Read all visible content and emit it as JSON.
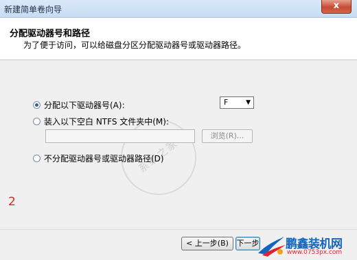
{
  "window": {
    "title": "新建简单卷向导",
    "close_symbol": "x"
  },
  "header": {
    "title": "分配驱动器号和路径",
    "subtitle": "为了便于访问，可以给磁盘分区分配驱动器号或驱动器路径。"
  },
  "watermark_text": "系统之家",
  "options": [
    {
      "label": "分配以下驱动器号(A):",
      "checked": true
    },
    {
      "label": "装入以下空白 NTFS 文件夹中(M):",
      "checked": false
    },
    {
      "label": "不分配驱动器号或驱动器路径(D)",
      "checked": false
    }
  ],
  "drive_select": {
    "value": "F",
    "arrow": "▼"
  },
  "path_input": {
    "value": ""
  },
  "browse_button": {
    "label": "浏览(R)..."
  },
  "annotation_number": "2",
  "footer": {
    "back_label": "< 上一步(B)",
    "next_label": "下一步"
  },
  "logo": {
    "name": "鹏鑫装机网",
    "url": "www.0753px.com"
  },
  "colors": {
    "accent": "#2a5fae",
    "close": "#c64b34",
    "annotation": "#d8281c",
    "logo_blue": "#1565c0",
    "logo_red": "#e2212e"
  }
}
